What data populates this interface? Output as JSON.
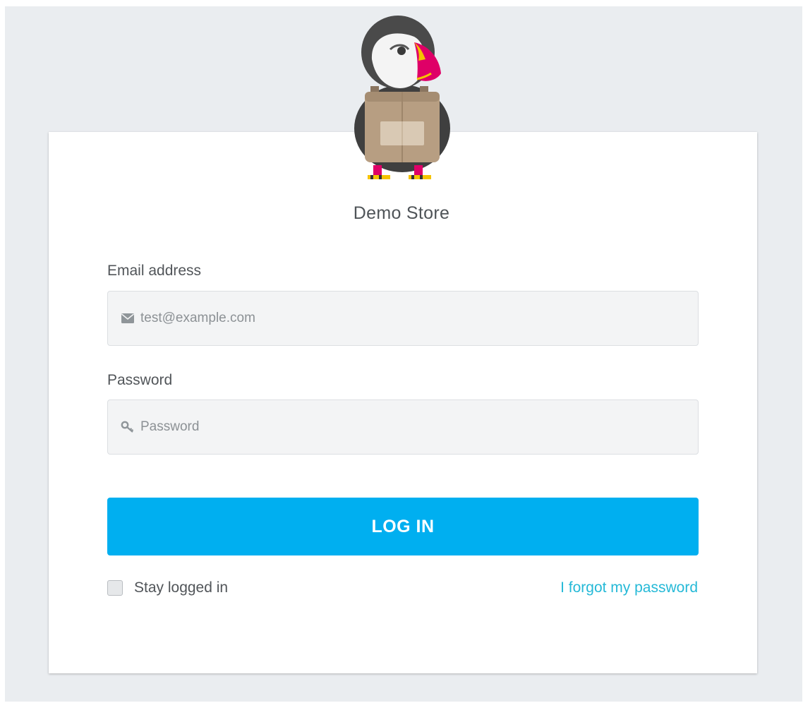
{
  "store": {
    "name": "Demo Store"
  },
  "login_form": {
    "email_label": "Email address",
    "email_placeholder": "test@example.com",
    "password_label": "Password",
    "password_placeholder": "Password",
    "login_button": "LOG IN",
    "stay_logged_in_label": "Stay logged in",
    "stay_logged_in_checked": false,
    "forgot_password_link": "I forgot my password"
  },
  "icons": {
    "email": "envelope-icon",
    "password": "key-icon",
    "logo": "puffin-mascot-logo"
  },
  "colors": {
    "primary_button": "#00aff0",
    "link": "#25b9d7",
    "page_background": "#eaedf0",
    "card_background": "#ffffff",
    "input_background": "#f3f4f5"
  }
}
